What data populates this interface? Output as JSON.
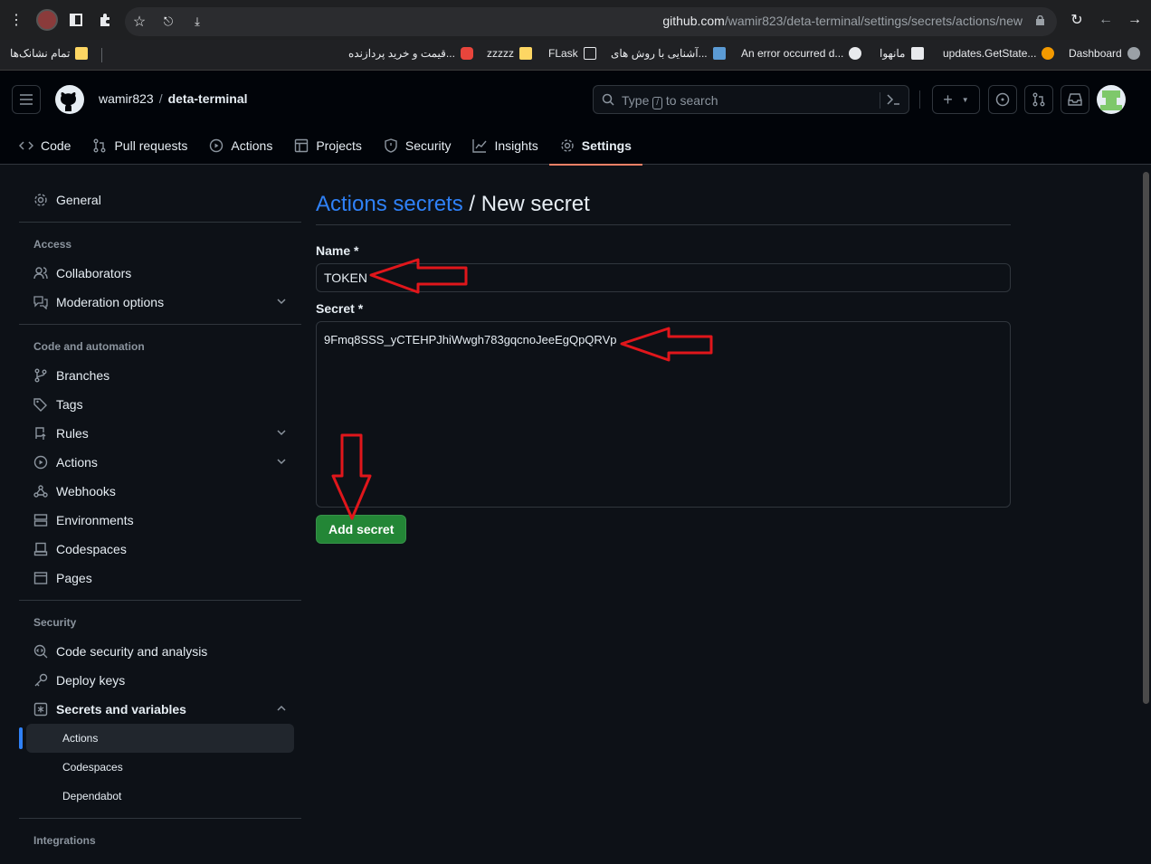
{
  "browser": {
    "url_host": "github.com",
    "url_path": "/wamir823/deta-terminal/settings/secrets/actions/new",
    "bookmarks": [
      {
        "label": "Dashboard",
        "color": "#9aa0a6"
      },
      {
        "label": "updates.GetState...",
        "color": "#f29900"
      },
      {
        "label": "مانهوا",
        "color": "#e8eaed"
      },
      {
        "label": "An error occurred d...",
        "color": "#e8eaed"
      },
      {
        "label": "آشنایی با روش های...",
        "color": "#5b9bd5"
      },
      {
        "label": "FLask",
        "color": "#e8eaed"
      },
      {
        "label": "zzzzz",
        "color": "#fdd663"
      },
      {
        "label": "قیمت و خرید پردازنده...",
        "color": "#e8453c"
      },
      {
        "label": "تمام نشانک‌ها",
        "color": "#fdd663"
      }
    ]
  },
  "header": {
    "owner": "wamir823",
    "repo": "deta-terminal",
    "search_placeholder_before": "Type",
    "search_key": "/",
    "search_placeholder_after": "to search"
  },
  "tabs": [
    {
      "label": "Code",
      "icon": "code-icon"
    },
    {
      "label": "Pull requests",
      "icon": "pull-request-icon"
    },
    {
      "label": "Actions",
      "icon": "play-icon"
    },
    {
      "label": "Projects",
      "icon": "table-icon"
    },
    {
      "label": "Security",
      "icon": "shield-icon"
    },
    {
      "label": "Insights",
      "icon": "graph-icon"
    },
    {
      "label": "Settings",
      "icon": "gear-icon",
      "active": true
    }
  ],
  "sidebar": {
    "general": "General",
    "access_heading": "Access",
    "collaborators": "Collaborators",
    "moderation": "Moderation options",
    "code_heading": "Code and automation",
    "branches": "Branches",
    "tags": "Tags",
    "rules": "Rules",
    "actions": "Actions",
    "webhooks": "Webhooks",
    "environments": "Environments",
    "codespaces": "Codespaces",
    "pages": "Pages",
    "security_heading": "Security",
    "code_security": "Code security and analysis",
    "deploy_keys": "Deploy keys",
    "secrets": "Secrets and variables",
    "secrets_actions": "Actions",
    "secrets_codespaces": "Codespaces",
    "secrets_dependabot": "Dependabot",
    "integrations_heading": "Integrations"
  },
  "main": {
    "title_link": "Actions secrets",
    "title_sep": "/",
    "title_rest": "New secret",
    "name_label": "Name *",
    "name_value": "TOKEN",
    "secret_label": "Secret *",
    "secret_value": "9Fmq8SSS_yCTEHPJhiWwgh783gqcnoJeeEgQpQRVp",
    "submit_label": "Add secret"
  },
  "colors": {
    "accent_link": "#2f81f7",
    "submit_green": "#238636",
    "tab_underline": "#f78166",
    "annotation_red": "#e0161b"
  }
}
